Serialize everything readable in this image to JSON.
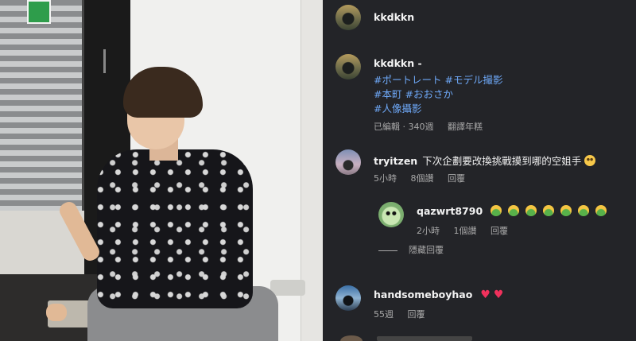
{
  "post": {
    "author": "kkdkkn",
    "caption": {
      "author": "kkdkkn -",
      "lines": [
        [
          "#ポートレート",
          "#モデル撮影"
        ],
        [
          "#本町",
          "#おおさか"
        ],
        [
          "#人像攝影"
        ]
      ],
      "meta": {
        "edited": "已編輯 · 340週",
        "translate": "翻譯年糕"
      }
    }
  },
  "comments": [
    {
      "username": "tryitzen",
      "text": "下次企劃要改換挑戰摸到哪的空姐手",
      "emoji": "thinking-face",
      "time": "5小時",
      "likes": "8個讚",
      "reply": "回覆",
      "replies": [
        {
          "username": "qazwrt8790",
          "emoji": [
            "nauseated-face",
            "nauseated-face",
            "nauseated-face",
            "nauseated-face",
            "nauseated-face",
            "nauseated-face",
            "nauseated-face"
          ],
          "time": "2小時",
          "likes": "1個讚",
          "reply": "回覆"
        }
      ],
      "hide_replies": "隱藏回覆"
    },
    {
      "username": "handsomeboyhao",
      "emoji": [
        "heart",
        "heart"
      ],
      "time": "55週",
      "reply": "回覆"
    }
  ],
  "colors": {
    "panel_bg": "#232428",
    "hashtag": "#6ea8f7",
    "meta": "#a8a8a8",
    "heart": "#f0315c"
  }
}
